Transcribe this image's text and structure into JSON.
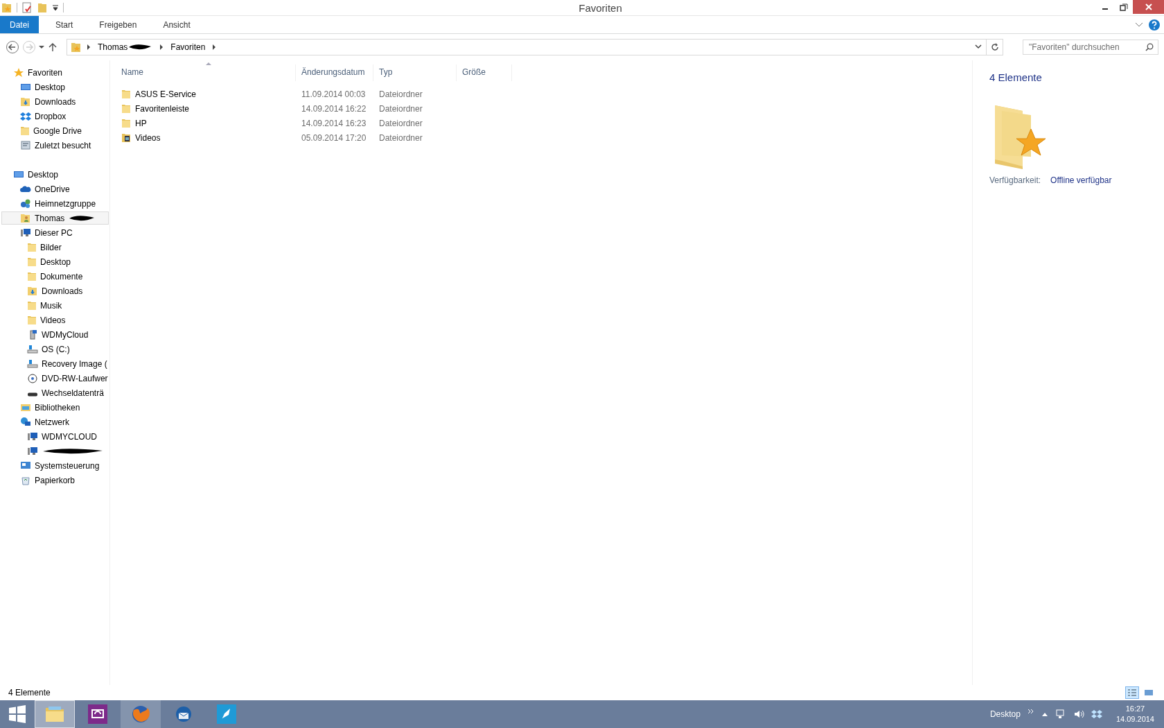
{
  "window": {
    "title": "Favoriten"
  },
  "ribbon": {
    "tabs": [
      {
        "label": "Datei",
        "kind": "file"
      },
      {
        "label": "Start",
        "kind": "tab"
      },
      {
        "label": "Freigeben",
        "kind": "tab"
      },
      {
        "label": "Ansicht",
        "kind": "tab"
      }
    ]
  },
  "address_bar": {
    "crumbs": [
      {
        "label": "Thomas",
        "redacted": true
      },
      {
        "label": "Favoriten",
        "redacted": false
      }
    ]
  },
  "search": {
    "placeholder": "\"Favoriten\" durchsuchen"
  },
  "navigation": [
    {
      "label": "Favoriten",
      "kind": "star",
      "selected": false,
      "children": [
        {
          "label": "Desktop",
          "kind": "monitor",
          "selected": false
        },
        {
          "label": "Downloads",
          "kind": "folder-down",
          "selected": false
        },
        {
          "label": "Dropbox",
          "kind": "dropbox",
          "selected": false
        },
        {
          "label": "Google Drive",
          "kind": "folder",
          "selected": false
        },
        {
          "label": "Zuletzt besucht",
          "kind": "recent",
          "selected": false
        }
      ]
    },
    {
      "label": "Desktop",
      "kind": "monitor",
      "selected": false,
      "children": [
        {
          "label": "OneDrive",
          "kind": "cloud",
          "selected": false
        },
        {
          "label": "Heimnetzgruppe",
          "kind": "homegroup",
          "selected": false
        },
        {
          "label": "Thomas",
          "kind": "user-folder",
          "selected": true,
          "redacted": true
        },
        {
          "label": "Dieser PC",
          "kind": "computer",
          "selected": false,
          "children": [
            {
              "label": "Bilder",
              "kind": "folder",
              "selected": false
            },
            {
              "label": "Desktop",
              "kind": "folder",
              "selected": false
            },
            {
              "label": "Dokumente",
              "kind": "folder",
              "selected": false
            },
            {
              "label": "Downloads",
              "kind": "folder-down",
              "selected": false
            },
            {
              "label": "Musik",
              "kind": "folder",
              "selected": false
            },
            {
              "label": "Videos",
              "kind": "folder",
              "selected": false
            },
            {
              "label": "WDMyCloud",
              "kind": "nas",
              "selected": false
            },
            {
              "label": "OS (C:)",
              "kind": "drive",
              "selected": false
            },
            {
              "label": "Recovery Image (",
              "kind": "drive",
              "selected": false
            },
            {
              "label": "DVD-RW-Laufwer",
              "kind": "optical",
              "selected": false
            },
            {
              "label": "Wechseldatenträ",
              "kind": "removable",
              "selected": false
            }
          ]
        },
        {
          "label": "Bibliotheken",
          "kind": "library",
          "selected": false
        },
        {
          "label": "Netzwerk",
          "kind": "network",
          "selected": false,
          "children": [
            {
              "label": "WDMYCLOUD",
              "kind": "computer",
              "selected": false
            },
            {
              "kind": "computer",
              "selected": false,
              "redacted": true
            }
          ]
        },
        {
          "label": "Systemsteuerung",
          "kind": "control-panel",
          "selected": false
        },
        {
          "label": "Papierkorb",
          "kind": "recycle-bin",
          "selected": false
        }
      ]
    }
  ],
  "file_list": {
    "columns": [
      {
        "label": "Name",
        "sorted": true
      },
      {
        "label": "Änderungsdatum",
        "sorted": false
      },
      {
        "label": "Typ",
        "sorted": false
      },
      {
        "label": "Größe",
        "sorted": false
      }
    ],
    "rows": [
      {
        "name": "ASUS E-Service",
        "date": "11.09.2014 00:03",
        "type": "Dateiordner",
        "kind": "folder"
      },
      {
        "name": "Favoritenleiste",
        "date": "14.09.2014 16:22",
        "type": "Dateiordner",
        "kind": "folder"
      },
      {
        "name": "HP",
        "date": "14.09.2014 16:23",
        "type": "Dateiordner",
        "kind": "folder"
      },
      {
        "name": "Videos",
        "date": "05.09.2014 17:20",
        "type": "Dateiordner",
        "kind": "video-folder"
      }
    ]
  },
  "details_pane": {
    "count": "4 Elemente",
    "property_label": "Verfügbarkeit:",
    "property_value": "Offline verfügbar"
  },
  "status_bar": {
    "text": "4 Elemente",
    "views": [
      {
        "kind": "details",
        "selected": true
      },
      {
        "kind": "tiles",
        "selected": false
      }
    ]
  },
  "taskbar": {
    "apps": [
      {
        "kind": "explorer",
        "running": true,
        "active": true
      },
      {
        "kind": "screen",
        "running": false,
        "active": false
      },
      {
        "kind": "firefox",
        "running": true,
        "active": false
      },
      {
        "kind": "mail",
        "running": false,
        "active": false
      },
      {
        "kind": "rocket",
        "running": false,
        "active": false
      }
    ],
    "toolbar_label": "Desktop",
    "time": "16:27",
    "date": "14.09.2014"
  }
}
